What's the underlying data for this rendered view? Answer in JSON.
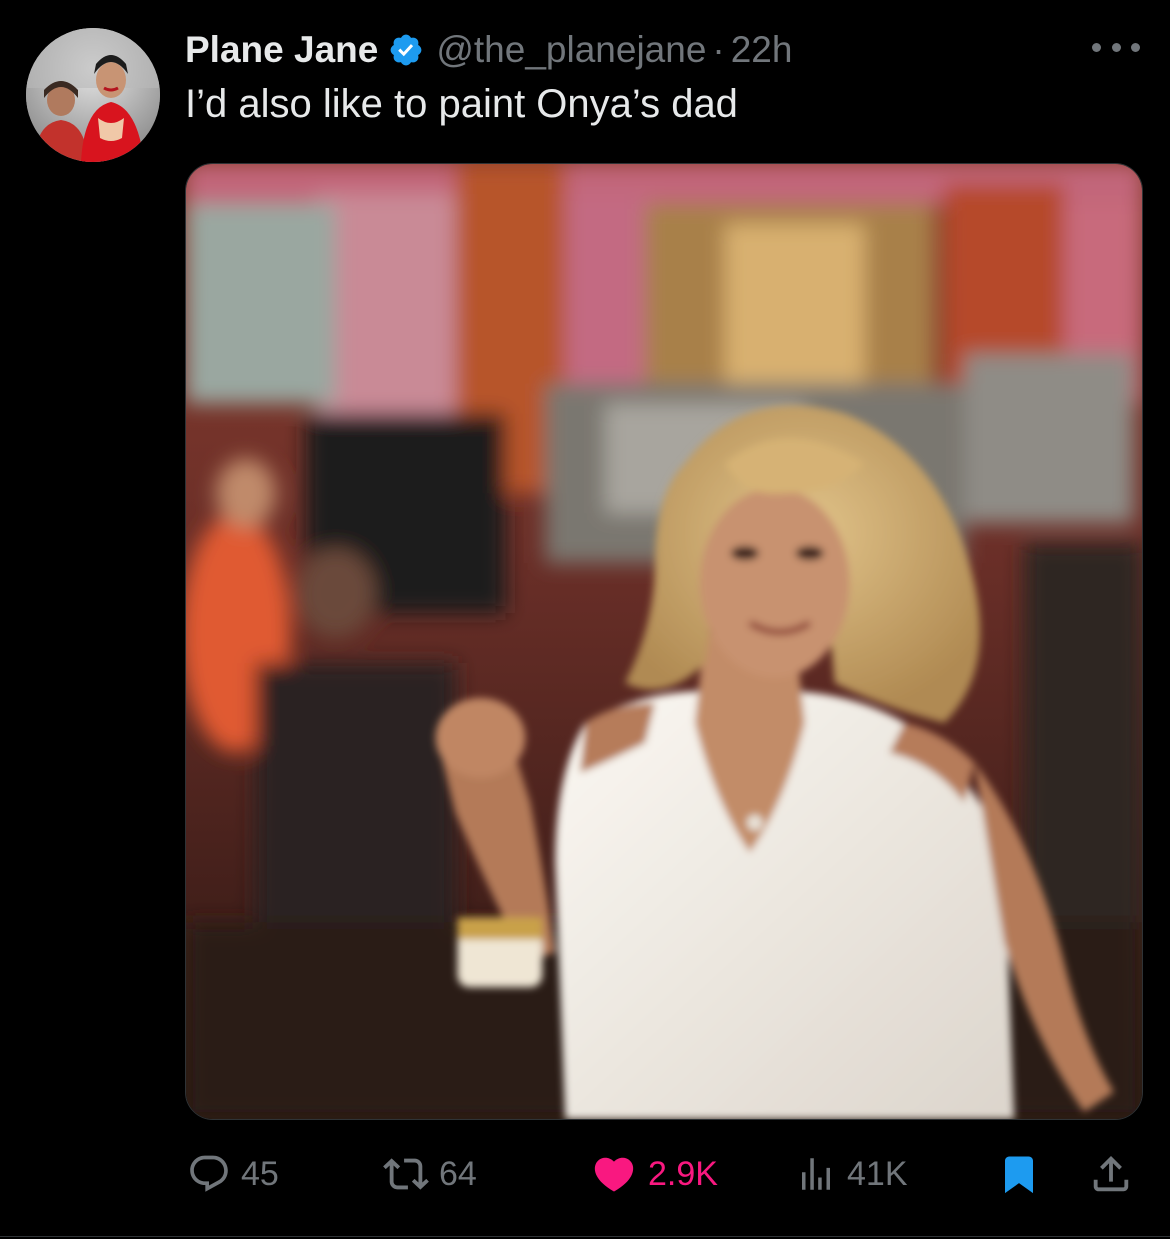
{
  "author": {
    "display_name": "Plane Jane",
    "handle": "@the_planejane",
    "separator": "·",
    "time": "22h",
    "verified": true,
    "avatar_icon": "profile-photo"
  },
  "tweet": {
    "text": "I’d also like to paint Onya’s dad"
  },
  "media": {
    "kind": "photo",
    "description_icon": "media-photo"
  },
  "actions": {
    "reply": {
      "count": "45",
      "icon": "reply-icon"
    },
    "retweet": {
      "count": "64",
      "icon": "retweet-icon"
    },
    "like": {
      "count": "2.9K",
      "icon": "heart-filled-icon",
      "color": "#f91880"
    },
    "views": {
      "count": "41K",
      "icon": "views-icon"
    },
    "bookmark": {
      "icon": "bookmark-filled-icon",
      "color": "#1d9bf0"
    },
    "share": {
      "icon": "share-icon"
    }
  },
  "colors": {
    "background": "#000000",
    "primary_text": "#e7e9ea",
    "secondary_text": "#71767b",
    "verified_badge": "#1d9bf0"
  }
}
